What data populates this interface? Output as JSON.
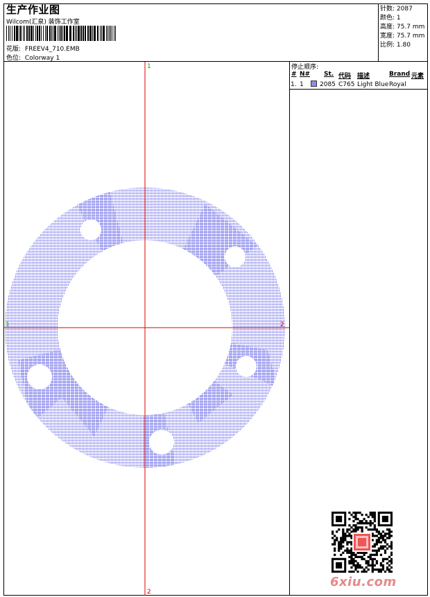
{
  "header": {
    "title": "生产作业图",
    "company": "Wilcom(汇泉) 装饰工作室",
    "design_label": "花版:",
    "design_file": "FREEV4_710.EMB",
    "colorway_label": "色位:",
    "colorway": "Colorway 1"
  },
  "stats": [
    {
      "label": "针数:",
      "value": "2087"
    },
    {
      "label": "颜色:",
      "value": "1"
    },
    {
      "label": "高度:",
      "value": "75.7 mm"
    },
    {
      "label": "宽度:",
      "value": "75.7 mm"
    },
    {
      "label": "比例:",
      "value": "1.80"
    }
  ],
  "stop_sequence": {
    "title": "停止顺序:",
    "columns": [
      "#",
      "N#",
      "St.",
      "代码",
      "描述",
      "Brand",
      "元素"
    ],
    "rows": [
      {
        "num": "1.",
        "n": "1",
        "stitches": "2085",
        "code": "C765",
        "description": "Light Blue",
        "brand": "Royal",
        "swatch_color": "#8c8cf0"
      }
    ]
  },
  "axis_labels": {
    "top": "1",
    "bottom": "2",
    "left": "1",
    "right": "2"
  },
  "colors": {
    "thread": "#8c8cf0",
    "axis": "#e00000",
    "axis_label_green": "#00b000"
  },
  "watermark": "6xiu.com"
}
